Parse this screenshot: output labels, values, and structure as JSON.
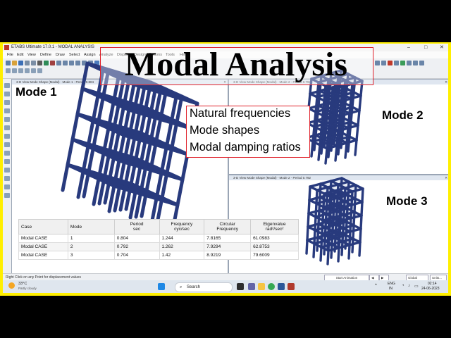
{
  "window": {
    "title": "ETABS Ultimate 17.0.1 - MODAL ANALYSIS",
    "controls": [
      "–",
      "□",
      "✕"
    ]
  },
  "menu": [
    "File",
    "Edit",
    "View",
    "Define",
    "Draw",
    "Select",
    "Assign",
    "Analyze",
    "Display",
    "Design",
    "Options",
    "Tools",
    "Help"
  ],
  "overlay": {
    "title": "Modal Analysis",
    "properties": [
      "Natural frequencies",
      "Mode shapes",
      "Modal damping ratios"
    ]
  },
  "panes": {
    "mode1": {
      "header": "3-D View  Mode Shape (Modal) - Mode 1 - Period 0.804",
      "label": "Mode 1"
    },
    "mode2": {
      "header": "3-D View  Mode Shape (Modal) - Mode 2 - Period 0.792",
      "label": "Mode 2"
    },
    "mode3": {
      "header": "3-D View  Mode Shape (Modal) - Mode 2 - Period 0.792",
      "label": "Mode 3"
    }
  },
  "table": {
    "headers": [
      "Case",
      "Mode",
      "Period\nsec",
      "Frequency\ncyc/sec",
      "Circular\nFrequency",
      "Eigenvalue\nrad²/sec²"
    ],
    "rows": [
      [
        "Modal CASE",
        "1",
        "0.804",
        "1.244",
        "7.8165",
        "61.0983"
      ],
      [
        "Modal CASE",
        "2",
        "0.792",
        "1.262",
        "7.9294",
        "62.8753"
      ],
      [
        "Modal CASE",
        "3",
        "0.704",
        "1.42",
        "8.9219",
        "79.6009"
      ]
    ]
  },
  "statusbar": {
    "hint": "Right Click on any Point for displacement values",
    "start_animation": "Start Animation",
    "global": "Global",
    "units": "Units..."
  },
  "taskbar": {
    "weather_temp": "33°C",
    "weather_desc": "Partly cloudy",
    "search_placeholder": "Search",
    "lang": "ENG",
    "region": "IN",
    "time": "02:14",
    "date": "24-06-2023"
  },
  "colors": {
    "frame": "#ffef00",
    "highlight": "#e0202a",
    "structure": "#283a7d"
  }
}
